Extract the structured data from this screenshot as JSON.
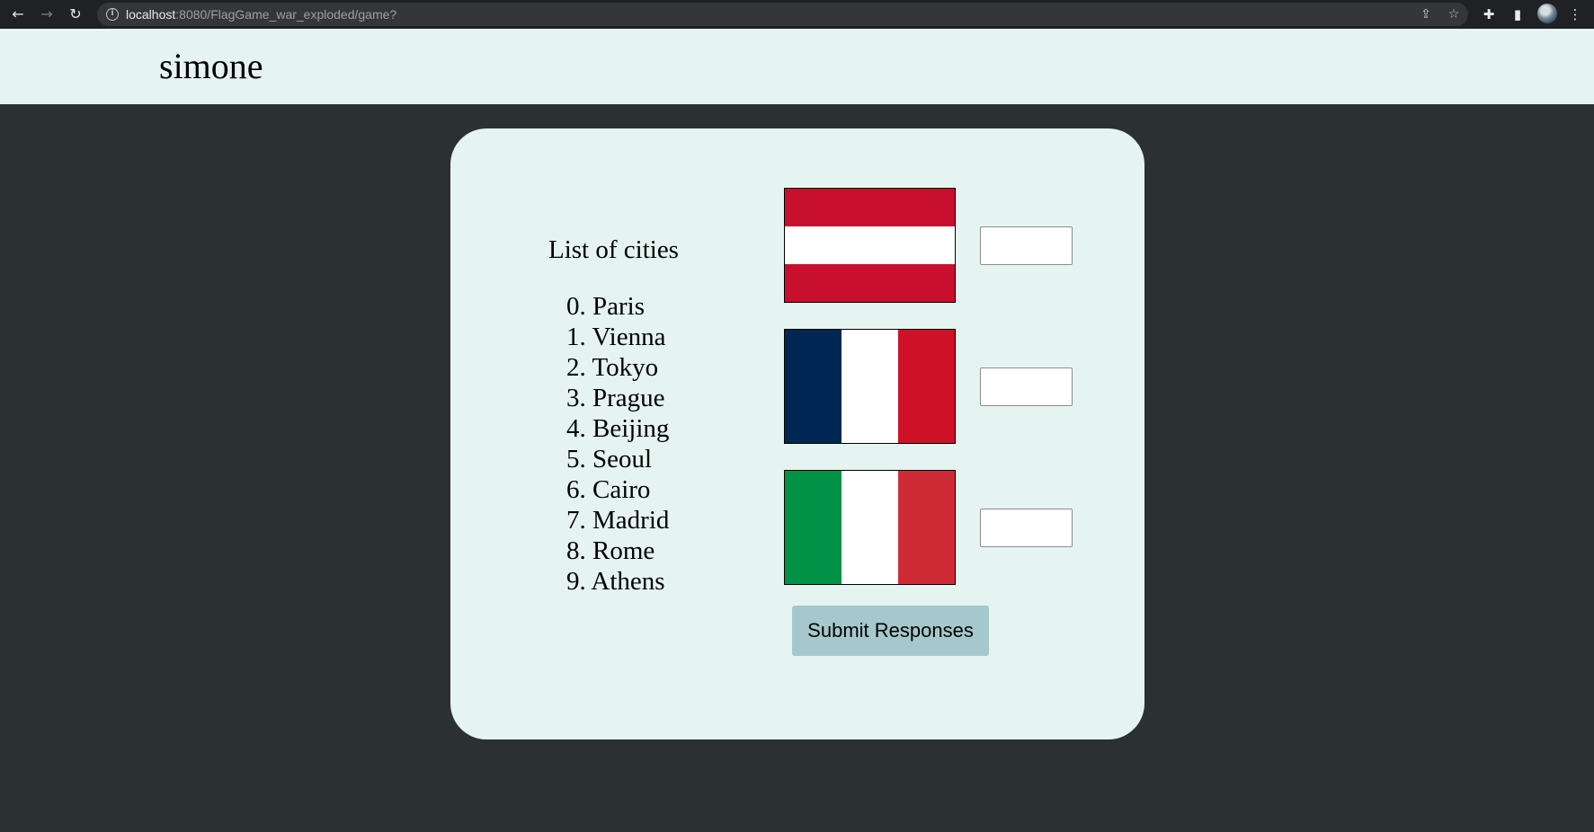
{
  "browser": {
    "url_host": "localhost",
    "url_rest": ":8080/FlagGame_war_exploded/game?",
    "icons": [
      "back-arrow-icon",
      "forward-arrow-icon",
      "reload-icon",
      "info-icon",
      "share-icon",
      "star-icon",
      "extensions-icon",
      "side-panel-icon",
      "avatar",
      "menu-icon"
    ]
  },
  "header": {
    "username": "simone",
    "background": "#e5f4f1"
  },
  "cities": {
    "title": "List of cities",
    "items": [
      "0. Paris",
      "1. Vienna",
      "2. Tokyo",
      "3. Prague",
      "4. Beijing",
      "5. Seoul",
      "6. Cairo",
      "7. Madrid",
      "8. Rome",
      "9. Athens"
    ]
  },
  "flags": [
    {
      "country": "Austria",
      "orientation": "horizontal",
      "colors": [
        "#c8102e",
        "#ffffff",
        "#c8102e"
      ],
      "answer": ""
    },
    {
      "country": "France",
      "orientation": "vertical",
      "colors": [
        "#002654",
        "#ffffff",
        "#ce1126"
      ],
      "answer": ""
    },
    {
      "country": "Italy",
      "orientation": "vertical",
      "colors": [
        "#009246",
        "#ffffff",
        "#ce2b37"
      ],
      "answer": ""
    }
  ],
  "submit": {
    "label": "Submit Responses",
    "color": "#a5c8cc"
  },
  "colors": {
    "page_background": "#2b3130",
    "card_background": "#e5f4f1"
  }
}
